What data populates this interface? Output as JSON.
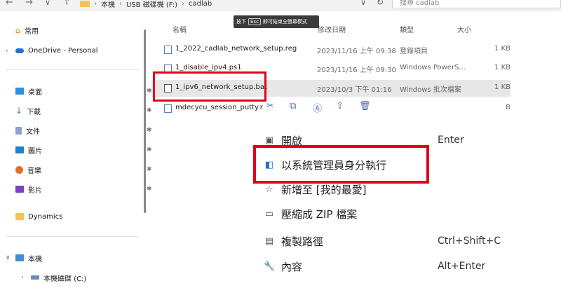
{
  "address": {
    "back": "←",
    "forward": "→",
    "recent": "∨",
    "up": "↑",
    "crumbs": [
      "本機",
      "USB 磁碟機 (F:)",
      "cadlab"
    ],
    "refresh": "↻",
    "search_placeholder": "搜尋 cadlab"
  },
  "toast": {
    "prefix": "按下",
    "key": "Esc",
    "suffix": "即可結束全螢幕模式"
  },
  "sidebar": {
    "home": "常用",
    "onedrive": "OneDrive - Personal",
    "desktop": "桌面",
    "downloads": "下載",
    "documents": "文件",
    "pictures": "圖片",
    "music": "音樂",
    "videos": "影片",
    "dynamics": "Dynamics",
    "this_pc": "本機",
    "local_disk": "本機磁碟 (C:)"
  },
  "columns": {
    "name": "名稱",
    "date": "修改日期",
    "type": "類型",
    "size": "大小"
  },
  "files": [
    {
      "name": "1_2022_cadlab_network_setup.reg",
      "date": "2023/11/16 上午 09:38",
      "type": "登錄項目",
      "size": "1 KB"
    },
    {
      "name": "1_disable_ipv4.ps1",
      "date": "2023/11/16 上午 09:30",
      "type": "Windows PowerS...",
      "size": "1 KB"
    },
    {
      "name": "1_ipv6_network_setup.bat",
      "date": "2023/10/3 下午 01:16",
      "type": "Windows 批次檔案",
      "size": "1 KB"
    },
    {
      "name": "mdecycu_session_putty.r",
      "date": "",
      "type": "",
      "size": "B"
    }
  ],
  "context_menu": {
    "open": "開啟",
    "open_sc": "Enter",
    "run_as_admin": "以系統管理員身分執行",
    "add_favorites": "新增至 [我的最愛]",
    "compress_zip": "壓縮成 ZIP 檔案",
    "copy_path": "複製路徑",
    "copy_path_sc": "Ctrl+Shift+C",
    "properties": "內容",
    "properties_sc": "Alt+Enter"
  },
  "colors": {
    "highlight": "#e0001a",
    "selected_row": "#e7e7e7",
    "folder": "#f5c44a"
  }
}
